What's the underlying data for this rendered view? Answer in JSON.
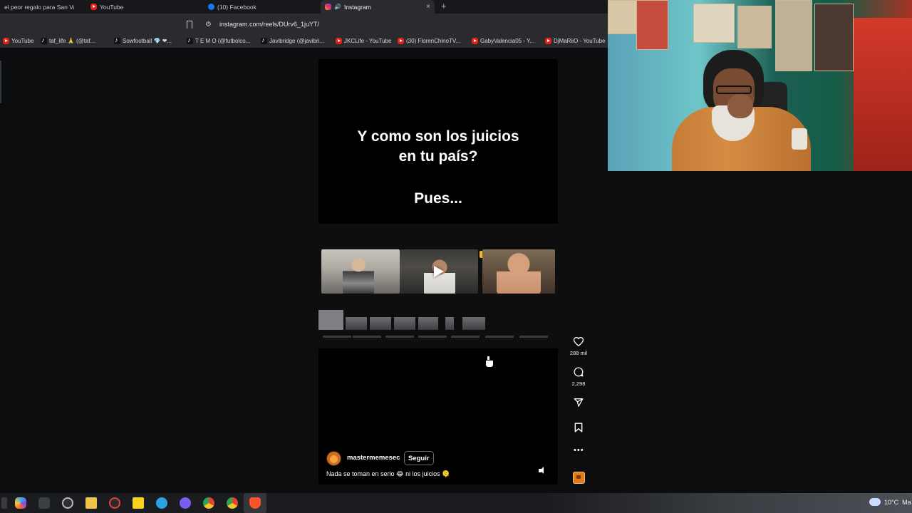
{
  "browser": {
    "tabs": [
      {
        "label": "el peor regalo para San Valentín",
        "favicon": "youtube-icon"
      },
      {
        "label": "YouTube",
        "favicon": "youtube-icon"
      },
      {
        "label": "(10) Facebook",
        "favicon": "facebook-icon"
      },
      {
        "label": "Instagram",
        "favicon": "instagram-icon",
        "active": true
      }
    ],
    "new_tab_glyph": "+",
    "close_glyph": "×",
    "url": "instagram.com/reels/DUrv6_1juYT/",
    "bookmarks": [
      {
        "label": "YouTube",
        "favicon": "youtube-icon"
      },
      {
        "label": "taf_life 🙏 (@taf...",
        "favicon": "tiktok-icon"
      },
      {
        "label": "Sowfootball 💎 ❤...",
        "favicon": "tiktok-icon"
      },
      {
        "label": "T E M O (@futbolco...",
        "favicon": "tiktok-icon"
      },
      {
        "label": "Javibridge (@javibri...",
        "favicon": "tiktok-icon"
      },
      {
        "label": "JKCLife - YouTube",
        "favicon": "youtube-icon"
      },
      {
        "label": "(30) FlorenChinoTV...",
        "favicon": "youtube-icon"
      },
      {
        "label": "GabyValencia05 - Y...",
        "favicon": "youtube-icon"
      },
      {
        "label": "DjMaRiiO - YouTube",
        "favicon": "youtube-icon"
      }
    ]
  },
  "reel": {
    "text_line1": "Y como son los juicios",
    "text_line2": "en tu país?",
    "text_line3": "Pues...",
    "username": "mastermemesec",
    "follow_label": "Seguir",
    "caption": "Nada se toman en serio 😂 ni los juicios 🫠",
    "likes": "288 mil",
    "comments": "2,298"
  },
  "taskbar": {
    "weather": "10°C",
    "weather_extra": "Ma"
  },
  "colors": {
    "page_bg": "#0c0d0f",
    "reel_bg": "#000000",
    "chrome_bg": "#2a2b2f",
    "accent_youtube": "#e62117",
    "accent_facebook": "#1877f2"
  }
}
